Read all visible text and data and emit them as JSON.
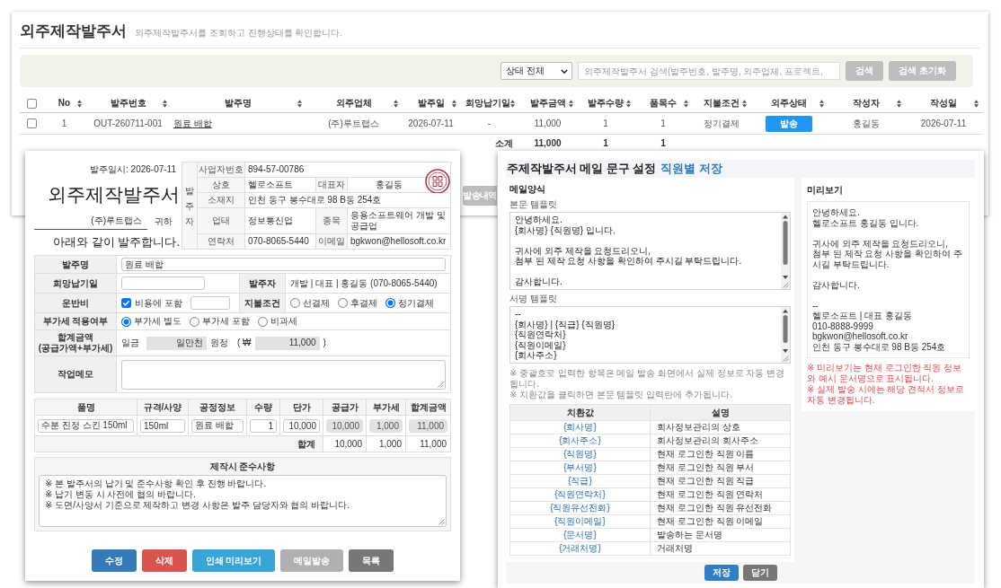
{
  "order_list_window": {
    "title": "외주제작발주서",
    "subtitle": "외주제작발주서를 조회하고 진행상태를 확인합니다.",
    "filter_bar": {
      "status_select": {
        "value": "상태 전체"
      },
      "search": {
        "placeholder": "외주제작발주서 검색(발주번호, 발주명, 외주업체, 프로젝트,"
      },
      "buttons": [
        "검색",
        "검색 초기화"
      ]
    },
    "table": {
      "select_all": {
        "checked": false
      },
      "columns": [
        "No",
        "발주번호",
        "발주명",
        "외주업체",
        "발주일",
        "희망납기일",
        "발주금액",
        "발주수량",
        "품목수",
        "지불조건",
        "외주상태",
        "작성자",
        "작성일"
      ],
      "rows": [
        {
          "checked": false,
          "no": "1",
          "order_number": "OUT-260711-001",
          "order_name": "원료 배합",
          "vendor": "(주)루트랩스",
          "order_date": "2026-07-11",
          "due_date": "-",
          "amount": "11,000",
          "quantity": "1",
          "item_count": "1",
          "payment_terms": "정기결제",
          "status": "발송",
          "author": "홍길동",
          "created_date": "2026-07-11"
        }
      ],
      "subtotal": {
        "label": "소계",
        "amount": "11,000",
        "quantity": "1",
        "item_count": "1"
      }
    },
    "history_button": "발송내역"
  },
  "order_document_window": {
    "issue_date": "발주일시: 2026-07-11",
    "title": "외주제작발주서",
    "recipient": "(주)루트랩스",
    "honorific": "귀하",
    "statement": "아래와 같이 발주합니다.",
    "orderer_info": {
      "heading": "발주자",
      "rows": [
        {
          "label": "사업자번호",
          "value": "894-57-00786",
          "stamped": false
        },
        {
          "label": "상호",
          "value": "헬로소프트",
          "label_2": "대표자",
          "value_2": "홍길동",
          "stamped": true
        },
        {
          "label": "소재지",
          "value": "인천 동구 봉수대로 98 B동 254호",
          "stamped": false
        },
        {
          "label": "업태",
          "value": "정보통신업",
          "label_2": "종목",
          "value_2": "응용소프트웨어 개발 및 공급업",
          "stamped": false
        },
        {
          "label": "연락처",
          "value": "070-8065-5440",
          "label_2": "이메일",
          "value_2": "bgkwon@hellosoft.co.kr",
          "stamped": false
        }
      ]
    },
    "form": {
      "order_name": {
        "label": "발주명",
        "value": "원료 배합"
      },
      "due_date": {
        "label": "희망납기일"
      },
      "orderer": {
        "label": "발주자",
        "value": "개발 | 대표 | 홍길동 (070-8065-5440)"
      },
      "shipping": {
        "label": "운반비",
        "option": "비용에 포함",
        "checked": true
      },
      "payment_terms": {
        "label": "지불조건",
        "options": [
          {
            "label": "선결제",
            "selected": false
          },
          {
            "label": "후결제",
            "selected": false
          },
          {
            "label": "정기결제",
            "selected": true
          }
        ]
      },
      "vat": {
        "label": "부가세 적용여부",
        "options": [
          {
            "label": "부가세 별도",
            "selected": true
          },
          {
            "label": "부가세 포함",
            "selected": false
          },
          {
            "label": "비과세",
            "selected": false
          }
        ]
      },
      "total": {
        "label": "합계금액 (공급가액+부가세)",
        "prefix": "일금",
        "amount_in_words": "일만천",
        "suffix": "원정",
        "currency_prefix": "( ₩",
        "amount": "11,000",
        "currency_suffix": ")"
      },
      "memo": {
        "label": "작업메모"
      }
    },
    "items": {
      "columns": [
        "품명",
        "규격/사양",
        "공정정보",
        "수량",
        "단가",
        "공급가",
        "부가세",
        "합계금액"
      ],
      "rows": [
        {
          "cells": [
            {
              "value": "수분 진정 스킨 150ml",
              "disabled": false
            },
            {
              "value": "150ml",
              "disabled": false
            },
            {
              "value": "원료 배합",
              "disabled": false
            },
            {
              "value": "1",
              "disabled": false
            },
            {
              "value": "10,000",
              "disabled": false
            },
            {
              "value": "10,000",
              "disabled": true
            },
            {
              "value": "1,000",
              "disabled": true
            },
            {
              "value": "11,000",
              "disabled": true
            }
          ]
        }
      ],
      "total_label": "합계",
      "totals": [
        "10,000",
        "1,000",
        "11,000"
      ]
    },
    "notes": {
      "heading": "제작시 준수사항",
      "text": "※ 본 발주서의 납기 및 준수사항 확인 후 진행 바랍니다.\n※ 납기 변동 시 사전에 협의 바랍니다.\n※ 도면/사양서 기준으로 제작하고 변경 사항은 발주 담당자와 협의 바랍니다."
    },
    "buttons": [
      {
        "label": "수정",
        "kind": "primary",
        "disabled": false
      },
      {
        "label": "삭제",
        "kind": "danger",
        "disabled": false
      },
      {
        "label": "인쇄 미리보기",
        "kind": "info",
        "disabled": false
      },
      {
        "label": "메일발송",
        "kind": "default",
        "disabled": true
      },
      {
        "label": "목록",
        "kind": "secondary",
        "disabled": false
      }
    ]
  },
  "mail_settings_window": {
    "title": "주제작발주서 메일 문구 설정",
    "title_emphasis": "직원별 저장",
    "template_form": {
      "heading": "메일양식",
      "body_label": "본문 템플릿",
      "body_text": "안녕하세요.\n{회사명} {직원명} 입니다.\n\n귀사에 외주 제작을 요청드리오니,\n첨부 된 제작 요청 사항을 확인하여 주시길 부탁드립니다.\n\n감사합니다.",
      "signature_label": "서명 템플릿",
      "signature_text": "--\n{회사명} | {직급} {직원명}\n{직원연락처}\n{직원이메일}\n{회사주소}",
      "notes": [
        "※ 중괄호로 입력한 항목은 메일 발송 화면에서 실제 정보로 자동 변경됩니다.",
        "※ 치환값을 클릭하면 본문 템플릿 입력란에 추가됩니다."
      ],
      "token_table": {
        "columns": [
          "치환값",
          "설명"
        ],
        "rows": [
          {
            "token": "{회사명}",
            "description": "회사정보관리의 상호"
          },
          {
            "token": "{회사주소}",
            "description": "회사정보관리의 회사주소"
          },
          {
            "token": "{직원명}",
            "description": "현재 로그인한 직원 이름"
          },
          {
            "token": "{부서명}",
            "description": "현재 로그인한 직원 부서"
          },
          {
            "token": "{직급}",
            "description": "현재 로그인한 직원 직급"
          },
          {
            "token": "{직원연락처}",
            "description": "현재 로그인한 직원 연락처"
          },
          {
            "token": "{직원유선전화}",
            "description": "현재 로그인한 직원 유선전화"
          },
          {
            "token": "{직원이메일}",
            "description": "현재 로그인한 직원 이메일"
          },
          {
            "token": "{문서명}",
            "description": "발송하는 문서명"
          },
          {
            "token": "{거래처명}",
            "description": "거래처명"
          }
        ]
      }
    },
    "preview": {
      "heading": "미리보기",
      "text": "안녕하세요.\n헬로소프트 홍길동 입니다.\n\n귀사에 외주 제작을 요청드리오니,\n첨부 된 제작 요청 사항을 확인하여 주시길 부탁드립니다.\n\n감사합니다.\n\n--\n헬로소프트 | 대표 홍길동\n010-8888-9999\nbgkwon@hellosoft.co.kr\n인천 동구 봉수대로 98 B동 254호",
      "notes": [
        "※ 미리보기는 현재 로그인한 직원 정보와 예시 문서명으로 표시됩니다.",
        "※ 실제 발송 시에는 해당 견적서 정보로 자동 변경됩니다."
      ]
    },
    "buttons": [
      {
        "label": "저장",
        "kind": "primary"
      },
      {
        "label": "닫기",
        "kind": "secondary"
      }
    ]
  }
}
